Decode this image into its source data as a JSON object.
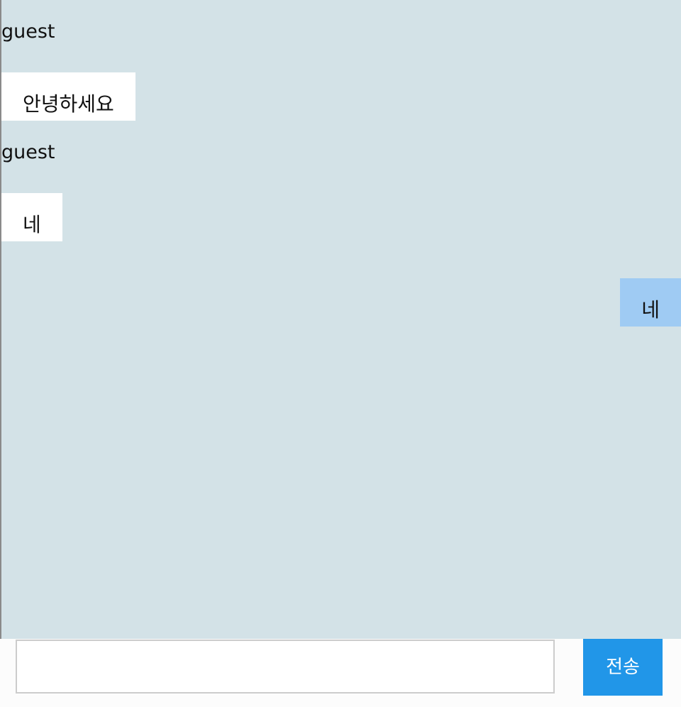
{
  "chat": {
    "messages": [
      {
        "sender": "guest",
        "text": "안녕하세요",
        "direction": "incoming"
      },
      {
        "sender": "guest",
        "text": "네",
        "direction": "incoming"
      },
      {
        "text": "네",
        "direction": "outgoing"
      }
    ]
  },
  "composer": {
    "input_value": "",
    "send_label": "전송"
  },
  "colors": {
    "chat_background": "#d3e2e7",
    "incoming_bubble": "#ffffff",
    "outgoing_bubble": "#9fcbf3",
    "send_button": "#2196e8"
  }
}
